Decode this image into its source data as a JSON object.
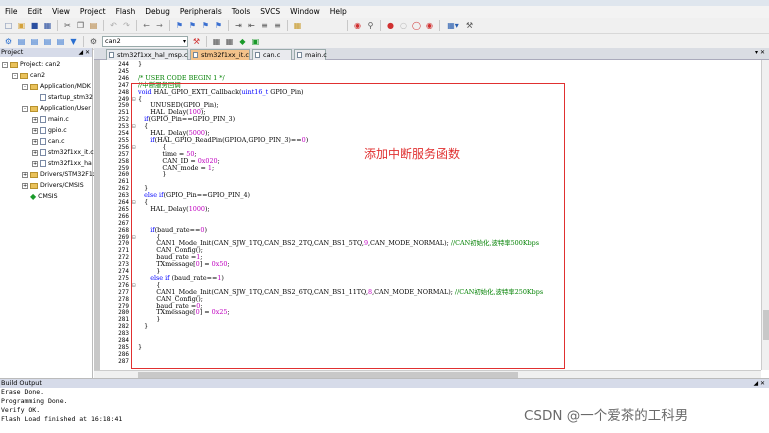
{
  "menu": [
    "File",
    "Edit",
    "View",
    "Project",
    "Flash",
    "Debug",
    "Peripherals",
    "Tools",
    "SVCS",
    "Window",
    "Help"
  ],
  "toolbar": {
    "target": "can2"
  },
  "project_panel": {
    "title": "Project",
    "tree": [
      {
        "label": "Project: can2",
        "indent": 0,
        "icon": "project",
        "exp": "-"
      },
      {
        "label": "can2",
        "indent": 1,
        "icon": "folder",
        "exp": "-"
      },
      {
        "label": "Application/MDK",
        "indent": 2,
        "icon": "folder",
        "exp": "-"
      },
      {
        "label": "startup_stm32",
        "indent": 3,
        "icon": "file",
        "exp": ""
      },
      {
        "label": "Application/User",
        "indent": 2,
        "icon": "folder",
        "exp": "-"
      },
      {
        "label": "main.c",
        "indent": 3,
        "icon": "file",
        "exp": "+"
      },
      {
        "label": "gpio.c",
        "indent": 3,
        "icon": "file",
        "exp": "+"
      },
      {
        "label": "can.c",
        "indent": 3,
        "icon": "file",
        "exp": "+"
      },
      {
        "label": "stm32f1xx_it.c",
        "indent": 3,
        "icon": "file",
        "exp": "+"
      },
      {
        "label": "stm32f1xx_ha",
        "indent": 3,
        "icon": "file",
        "exp": "+"
      },
      {
        "label": "Drivers/STM32F1x",
        "indent": 2,
        "icon": "folder",
        "exp": "+"
      },
      {
        "label": "Drivers/CMSIS",
        "indent": 2,
        "icon": "folder",
        "exp": "+"
      },
      {
        "label": "CMSIS",
        "indent": 2,
        "icon": "gem",
        "exp": ""
      }
    ],
    "tabs": [
      "P...",
      "B...",
      "{}",
      "0..."
    ]
  },
  "editor_tabs": [
    {
      "label": "stm32f1xx_hal_msp.c",
      "active": false
    },
    {
      "label": "stm32f1xx_it.c",
      "active": true
    },
    {
      "label": "can.c",
      "active": false
    },
    {
      "label": "main.c",
      "active": false
    }
  ],
  "code_lines": [
    {
      "n": "244",
      "f": "",
      "t": "}",
      "c": ""
    },
    {
      "n": "245",
      "f": "",
      "t": "",
      "c": ""
    },
    {
      "n": "246",
      "f": "",
      "t": "/* USER CODE BEGIN 1 */",
      "c": "cm"
    },
    {
      "n": "247",
      "f": "",
      "t": "//中断服务回调",
      "c": "cm"
    },
    {
      "n": "248",
      "f": "",
      "t": "void HAL_GPIO_EXTI_Callback(uint16_t GPIO_Pin)",
      "c": "kwline"
    },
    {
      "n": "249",
      "f": "⊟",
      "t": "{",
      "c": ""
    },
    {
      "n": "250",
      "f": "",
      "t": "      UNUSED(GPIO_Pin);",
      "c": ""
    },
    {
      "n": "251",
      "f": "",
      "t": "      HAL_Delay(100);",
      "c": "num100"
    },
    {
      "n": "252",
      "f": "",
      "t": "   if(GPIO_Pin==GPIO_PIN_3)",
      "c": "ifline"
    },
    {
      "n": "253",
      "f": "⊟",
      "t": "   {",
      "c": ""
    },
    {
      "n": "254",
      "f": "",
      "t": "      HAL_Delay(5000);",
      "c": "num5000"
    },
    {
      "n": "255",
      "f": "",
      "t": "      if(HAL_GPIO_ReadPin(GPIOA,GPIO_PIN_3)==0)",
      "c": "ifline"
    },
    {
      "n": "256",
      "f": "⊟",
      "t": "            {",
      "c": ""
    },
    {
      "n": "257",
      "f": "",
      "t": "            time = 50;",
      "c": "num50"
    },
    {
      "n": "258",
      "f": "",
      "t": "            CAN_ID = 0x020;",
      "c": "num020"
    },
    {
      "n": "259",
      "f": "",
      "t": "            CAN_mode = 1;",
      "c": "num1"
    },
    {
      "n": "260",
      "f": "",
      "t": "            }",
      "c": ""
    },
    {
      "n": "261",
      "f": "",
      "t": "",
      "c": ""
    },
    {
      "n": "262",
      "f": "",
      "t": "   }",
      "c": ""
    },
    {
      "n": "263",
      "f": "",
      "t": "   else if(GPIO_Pin==GPIO_PIN_4)",
      "c": "elseif"
    },
    {
      "n": "264",
      "f": "⊟",
      "t": "   {",
      "c": ""
    },
    {
      "n": "265",
      "f": "",
      "t": "      HAL_Delay(1000);",
      "c": "num1000"
    },
    {
      "n": "266",
      "f": "",
      "t": "",
      "c": ""
    },
    {
      "n": "267",
      "f": "",
      "t": "",
      "c": ""
    },
    {
      "n": "268",
      "f": "",
      "t": "      if(baud_rate==0)",
      "c": "ifline"
    },
    {
      "n": "269",
      "f": "⊟",
      "t": "         {",
      "c": ""
    },
    {
      "n": "270",
      "f": "",
      "t": "         CAN1_Mode_Init(CAN_SJW_1TQ,CAN_BS2_2TQ,CAN_BS1_5TQ,9,CAN_MODE_NORMAL); //CAN初始化,波特率500Kbps",
      "c": "cmtail"
    },
    {
      "n": "271",
      "f": "",
      "t": "         CAN_Config();",
      "c": ""
    },
    {
      "n": "272",
      "f": "",
      "t": "         baud_rate =1;",
      "c": ""
    },
    {
      "n": "273",
      "f": "",
      "t": "         TXmessage[0] = 0x50;",
      "c": "num0x50"
    },
    {
      "n": "274",
      "f": "",
      "t": "         }",
      "c": ""
    },
    {
      "n": "275",
      "f": "",
      "t": "      else if (baud_rate==1)",
      "c": "elseif"
    },
    {
      "n": "276",
      "f": "⊟",
      "t": "         {",
      "c": ""
    },
    {
      "n": "277",
      "f": "",
      "t": "         CAN1_Mode_Init(CAN_SJW_1TQ,CAN_BS2_6TQ,CAN_BS1_11TQ,8,CAN_MODE_NORMAL); //CAN初始化,波特率250Kbps",
      "c": "cmtail"
    },
    {
      "n": "278",
      "f": "",
      "t": "         CAN_Config();",
      "c": ""
    },
    {
      "n": "279",
      "f": "",
      "t": "         baud_rate =0;",
      "c": ""
    },
    {
      "n": "280",
      "f": "",
      "t": "         TXmessage[0] = 0x25;",
      "c": "num0x25"
    },
    {
      "n": "281",
      "f": "",
      "t": "         }",
      "c": ""
    },
    {
      "n": "282",
      "f": "",
      "t": "   }",
      "c": ""
    },
    {
      "n": "283",
      "f": "",
      "t": "",
      "c": ""
    },
    {
      "n": "284",
      "f": "",
      "t": "",
      "c": ""
    },
    {
      "n": "285",
      "f": "",
      "t": "}",
      "c": ""
    },
    {
      "n": "286",
      "f": "",
      "t": "",
      "c": ""
    },
    {
      "n": "287",
      "f": "",
      "t": "",
      "c": ""
    }
  ],
  "annotation": "添加中断服务函数",
  "build_output": {
    "title": "Build Output",
    "lines": [
      "Erase Done.",
      "Programming Done.",
      "Verify OK.",
      "Flash Load finished at 16:18:41"
    ]
  },
  "watermark": "CSDN @一个爱茶的工科男",
  "colors": {
    "annotation": "#e03030",
    "keyword": "#0000ff",
    "comment": "#008000",
    "active_tab": "#f4c28a"
  }
}
